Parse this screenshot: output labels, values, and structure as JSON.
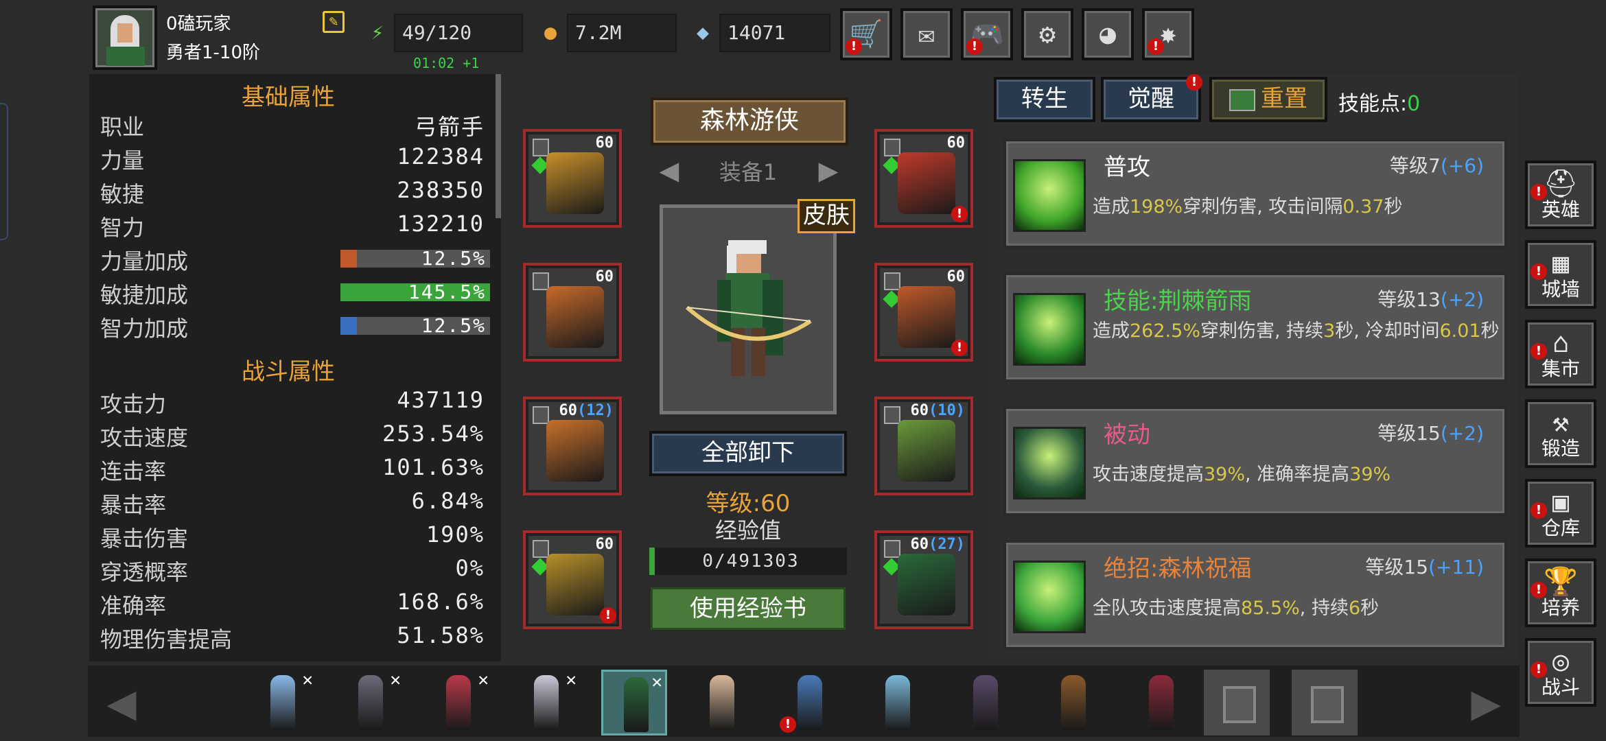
{
  "player": {
    "name": "0磕玩家",
    "rank": "勇者1-10阶"
  },
  "resources": {
    "energy": "49/120",
    "gold": "7.2M",
    "gems": "14071",
    "timer": "01:02 +1"
  },
  "toolbar": [
    {
      "name": "shop",
      "icon": "cart-icon",
      "glyph": "🛒",
      "alert": true
    },
    {
      "name": "mail",
      "icon": "mail-icon",
      "glyph": "✉",
      "alert": false
    },
    {
      "name": "gamepad",
      "icon": "gamepad-icon",
      "glyph": "🎮",
      "alert": true
    },
    {
      "name": "settings",
      "icon": "gear-icon",
      "glyph": "⚙",
      "alert": false
    },
    {
      "name": "lucky-wheel",
      "icon": "wheel-icon",
      "glyph": "◕",
      "alert": false
    },
    {
      "name": "fireworks",
      "icon": "fireworks-icon",
      "glyph": "✸",
      "alert": true
    }
  ],
  "stats": {
    "basic_title": "基础属性",
    "combat_title": "战斗属性",
    "basic": [
      {
        "label": "职业",
        "value": "弓箭手"
      },
      {
        "label": "力量",
        "value": "122384"
      },
      {
        "label": "敏捷",
        "value": "238350"
      },
      {
        "label": "智力",
        "value": "132210"
      }
    ],
    "bonuses": [
      {
        "label": "力量加成",
        "value": "12.5%",
        "fill": 0.11,
        "color": "#c0582a"
      },
      {
        "label": "敏捷加成",
        "value": "145.5%",
        "fill": 1.0,
        "color": "#3ba53b"
      },
      {
        "label": "智力加成",
        "value": "12.5%",
        "fill": 0.11,
        "color": "#3a6fc0"
      }
    ],
    "combat": [
      {
        "label": "攻击力",
        "value": "437119"
      },
      {
        "label": "攻击速度",
        "value": "253.54%"
      },
      {
        "label": "连击率",
        "value": "101.63%"
      },
      {
        "label": "暴击率",
        "value": "6.84%"
      },
      {
        "label": "暴击伤害",
        "value": "190%"
      },
      {
        "label": "穿透概率",
        "value": "0%"
      },
      {
        "label": "准确率",
        "value": "168.6%"
      },
      {
        "label": "物理伤害提高",
        "value": "51.58%"
      }
    ]
  },
  "equipment": {
    "hero_name": "森林游侠",
    "set_label": "装备1",
    "skin_label": "皮肤",
    "unequip_label": "全部卸下",
    "level": "等级:60",
    "exp_label": "经验值",
    "exp_value": "0/491303",
    "use_book_label": "使用经验书",
    "left_slots": [
      {
        "level": "60",
        "bonus": "",
        "art": "chest-armor",
        "color": "#c8902a",
        "gem": true,
        "alert": false
      },
      {
        "level": "60",
        "bonus": "",
        "art": "shoulder-armor",
        "color": "#c86a2a",
        "gem": false,
        "alert": false
      },
      {
        "level": "60",
        "bonus": "(12)",
        "art": "leg-armor",
        "color": "#c8702a",
        "gem": false,
        "alert": false
      },
      {
        "level": "60",
        "bonus": "",
        "art": "boots",
        "color": "#b8902a",
        "gem": true,
        "alert": true
      }
    ],
    "right_slots": [
      {
        "level": "60",
        "bonus": "",
        "art": "necklace",
        "color": "#c03a2a",
        "gem": true,
        "alert": true
      },
      {
        "level": "60",
        "bonus": "",
        "art": "bracers",
        "color": "#c05a2a",
        "gem": true,
        "alert": true
      },
      {
        "level": "60",
        "bonus": "(10)",
        "art": "ring",
        "color": "#6a9a3a",
        "gem": false,
        "alert": false
      },
      {
        "level": "60",
        "bonus": "(27)",
        "art": "crossbow",
        "color": "#2a6a3a",
        "gem": true,
        "alert": false
      }
    ]
  },
  "skills": {
    "tabs": [
      {
        "label": "转生",
        "alert": false
      },
      {
        "label": "觉醒",
        "alert": true
      }
    ],
    "reset_label": "重置",
    "points_label": "技能点:",
    "points_value": "0",
    "cards": [
      {
        "name": "普攻",
        "name_color": "#ffffff",
        "level": "等级7",
        "bonus": "(+6)",
        "desc_parts": [
          "造成",
          "198%",
          "穿刺伤害, 攻击间隔",
          "0.37",
          "秒"
        ],
        "icon_color": "#3fa52a"
      },
      {
        "name": "技能:荆棘箭雨",
        "name_color": "#4ad34a",
        "level": "等级13",
        "bonus": "(+2)",
        "desc_parts": [
          "造成",
          "262.5%",
          "穿刺伤害, 持续",
          "3",
          "秒, 冷却时间",
          "6.01",
          "秒"
        ],
        "icon_color": "#2a8a2a"
      },
      {
        "name": "被动",
        "name_color": "#e85a8a",
        "level": "等级15",
        "bonus": "(+2)",
        "desc_parts": [
          "攻击速度提高",
          "39%",
          ", 准确率提高",
          "39%"
        ],
        "icon_color": "#2a5a3a"
      },
      {
        "name": "绝招:森林祝福",
        "name_color": "#e8833a",
        "level": "等级15",
        "bonus": "(+11)",
        "desc_parts": [
          "全队攻击速度提高",
          "85.5%",
          ", 持续",
          "6",
          "秒"
        ],
        "icon_color": "#3aa53a"
      }
    ]
  },
  "side_menu": [
    {
      "label": "英雄",
      "icon": "helmet-icon",
      "glyph": "⛑",
      "alert": true
    },
    {
      "label": "城墙",
      "icon": "wall-icon",
      "glyph": "▦",
      "alert": true
    },
    {
      "label": "集市",
      "icon": "market-icon",
      "glyph": "⌂",
      "alert": true
    },
    {
      "label": "锻造",
      "icon": "anvil-icon",
      "glyph": "⚒",
      "alert": false
    },
    {
      "label": "仓库",
      "icon": "warehouse-icon",
      "glyph": "▣",
      "alert": true
    },
    {
      "label": "培养",
      "icon": "chalice-icon",
      "glyph": "🏆",
      "alert": true
    },
    {
      "label": "战斗",
      "icon": "portal-icon",
      "glyph": "◎",
      "alert": true
    }
  ],
  "heroes": [
    {
      "color": "#8ab8e8",
      "crossed": true,
      "selected": false,
      "alert": false
    },
    {
      "color": "#6a6a7a",
      "crossed": true,
      "selected": false,
      "alert": false
    },
    {
      "color": "#b83a4a",
      "crossed": true,
      "selected": false,
      "alert": false
    },
    {
      "color": "#c8c8d8",
      "crossed": true,
      "selected": false,
      "alert": false
    },
    {
      "color": "#2a6a3a",
      "crossed": true,
      "selected": true,
      "alert": false
    },
    {
      "color": "#d8b89a",
      "crossed": false,
      "selected": false,
      "alert": false
    },
    {
      "color": "#4a7ab8",
      "crossed": false,
      "selected": false,
      "alert": true
    },
    {
      "color": "#7ab8d8",
      "crossed": false,
      "selected": false,
      "alert": false
    },
    {
      "color": "#5a4a6a",
      "crossed": false,
      "selected": false,
      "alert": false
    },
    {
      "color": "#8a5a2a",
      "crossed": false,
      "selected": false,
      "alert": false
    },
    {
      "color": "#8a2a3a",
      "crossed": false,
      "selected": false,
      "alert": false
    }
  ],
  "locked_heroes": 2
}
